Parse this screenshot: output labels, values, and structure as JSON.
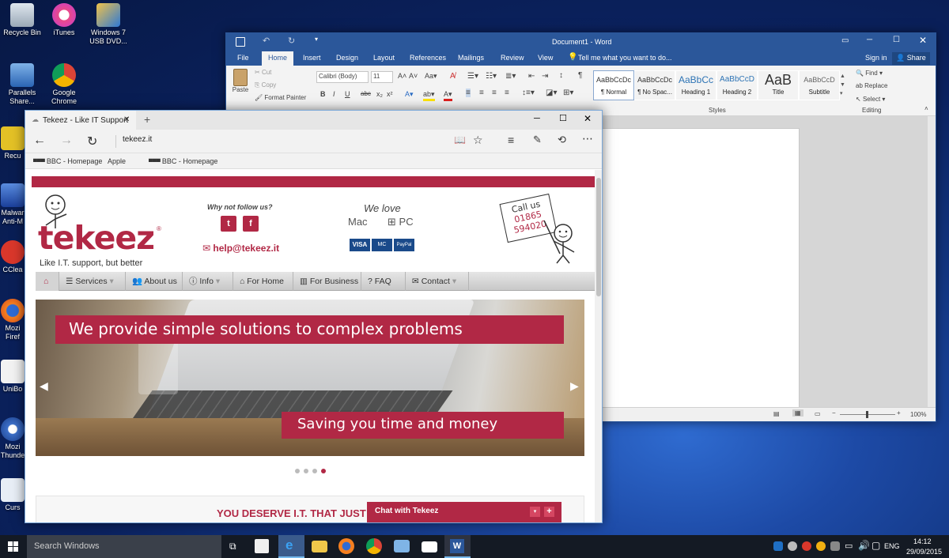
{
  "desktop": {
    "icons": [
      {
        "label": "Recycle Bin"
      },
      {
        "label": "iTunes"
      },
      {
        "label": "Windows 7 USB DVD..."
      },
      {
        "label": "Parallels Share..."
      },
      {
        "label": "Google Chrome"
      },
      {
        "label": "Recu"
      },
      {
        "label": "Malwar Anti-M"
      },
      {
        "label": "CClea"
      },
      {
        "label": "Mozi Firef"
      },
      {
        "label": "UniBo"
      },
      {
        "label": "Mozi Thunde"
      },
      {
        "label": "Curs"
      }
    ]
  },
  "word": {
    "title": "Document1 - Word",
    "tabs": [
      "File",
      "Home",
      "Insert",
      "Design",
      "Layout",
      "References",
      "Mailings",
      "Review",
      "View"
    ],
    "tell_me": "Tell me what you want to do...",
    "sign_in": "Sign in",
    "share": "Share",
    "clipboard": {
      "paste": "Paste",
      "cut": "Cut",
      "copy": "Copy",
      "format_painter": "Format Painter"
    },
    "font": {
      "name": "Calibri (Body)",
      "size": "11"
    },
    "styles": [
      {
        "preview": "AaBbCcDc",
        "name": "¶ Normal"
      },
      {
        "preview": "AaBbCcDc",
        "name": "¶ No Spac..."
      },
      {
        "preview": "AaBbCc",
        "name": "Heading 1"
      },
      {
        "preview": "AaBbCcD",
        "name": "Heading 2"
      },
      {
        "preview": "AaB",
        "name": "Title"
      },
      {
        "preview": "AaBbCcD",
        "name": "Subtitle"
      }
    ],
    "styles_label": "Styles",
    "editing": {
      "find": "Find",
      "replace": "Replace",
      "select": "Select",
      "label": "Editing"
    },
    "zoom": "100%"
  },
  "edge": {
    "tab_title": "Tekeez - Like IT Support",
    "url": "tekeez.it",
    "favorites": [
      "BBC - Homepage",
      "Apple",
      "BBC - Homepage"
    ]
  },
  "site": {
    "logo": "tekeez",
    "tagline": "Like I.T. support, but better",
    "follow": "Why not follow us?",
    "email": "help@tekeez.it",
    "we_love": "We love",
    "mac": "Mac",
    "pc": "PC",
    "cards": [
      "VISA",
      "MC",
      "PayPal"
    ],
    "call_us": "Call us",
    "phone_1": "01865",
    "phone_2": "594020",
    "menu": [
      "Services",
      "About us",
      "Info",
      "For Home",
      "For Business",
      "FAQ",
      "Contact"
    ],
    "slide_caption_1": "We provide simple solutions to complex problems",
    "slide_caption_2": "Saving you time and money",
    "section_heading": "YOU DESERVE I.T. THAT JUST",
    "chat": "Chat with Tekeez"
  },
  "taskbar": {
    "search": "Search Windows",
    "lang": "ENG",
    "time": "14:12",
    "date": "29/09/2015"
  },
  "colors": {
    "brand": "#b12845",
    "word_blue": "#2b579a",
    "taskbar": "#141a24"
  }
}
